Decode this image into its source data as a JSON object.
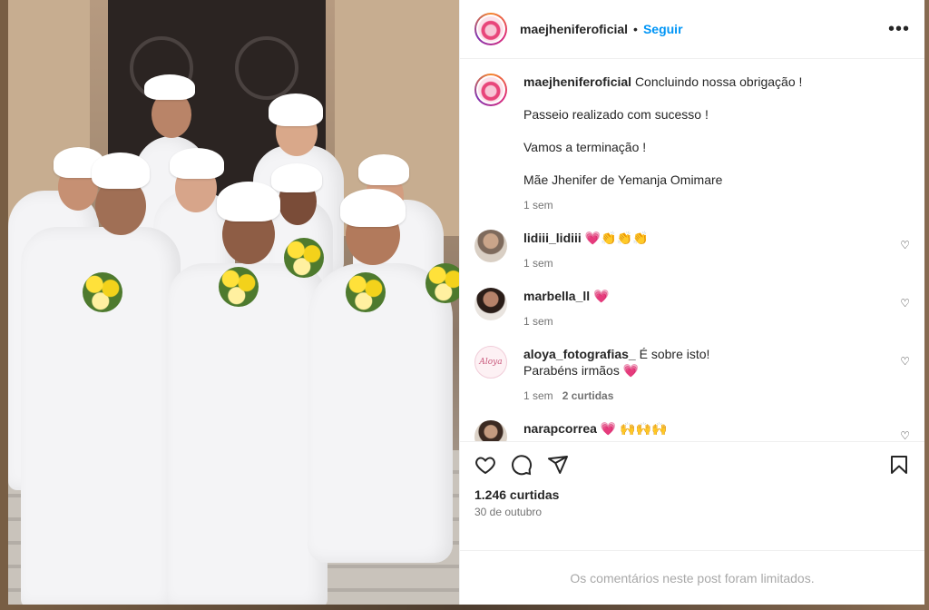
{
  "post": {
    "username": "maejheniferoficial",
    "dot": "•",
    "follow_label": "Seguir",
    "more_icon": "more-options-icon",
    "caption": {
      "username": "maejheniferoficial",
      "lines": [
        "Concluindo nossa obrigação !",
        "Passeio realizado com sucesso !",
        "Vamos a terminação !",
        "Mãe Jhenifer de Yemanja Omimare"
      ],
      "time": "1 sem"
    },
    "comments": [
      {
        "username": "lidiii_lidiii",
        "text": "💗👏👏👏",
        "time": "1 sem",
        "replies": ""
      },
      {
        "username": "marbella_ll",
        "text": "💗",
        "time": "1 sem",
        "replies": ""
      },
      {
        "username": "aloya_fotografias_",
        "text": "É sobre isto!",
        "text2": "Parabéns irmãos 💗",
        "time": "1 sem",
        "replies": "2 curtidas"
      },
      {
        "username": "narapcorrea",
        "text": "💗 🙌🙌🙌",
        "time": "",
        "replies": ""
      }
    ],
    "aloya_logo_text": "Aloya",
    "likes": "1.246 curtidas",
    "date": "30 de outubro",
    "comments_limited": "Os comentários neste post foram limitados."
  },
  "colors": {
    "link": "#0095f6",
    "text": "#262626",
    "muted": "#737373",
    "disabled": "#a8a8a8"
  }
}
